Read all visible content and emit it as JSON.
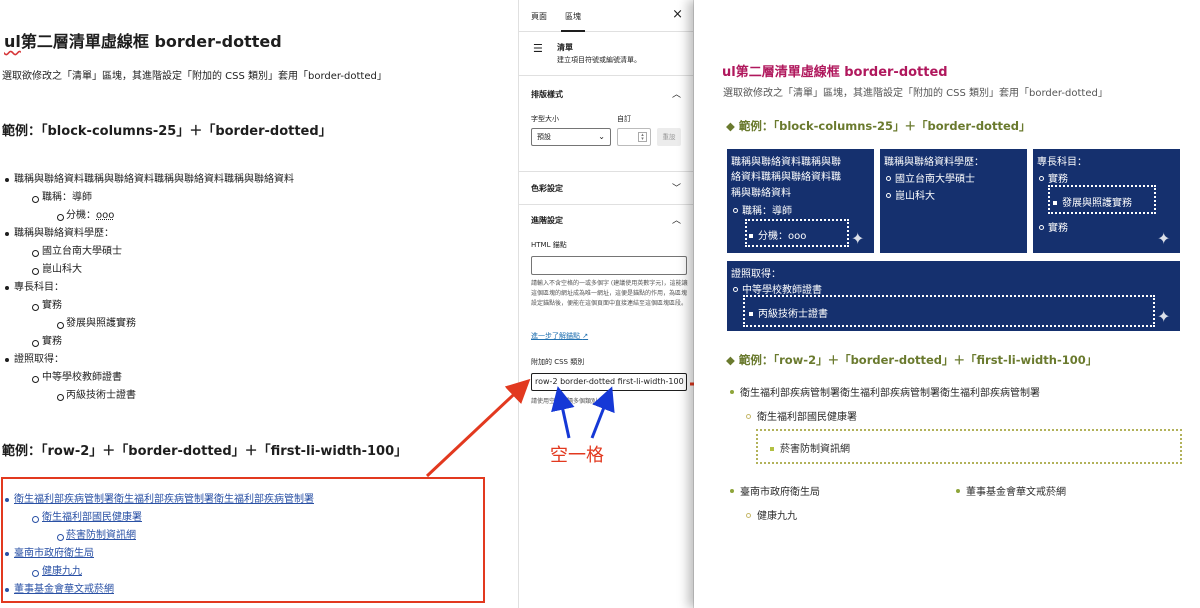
{
  "editor": {
    "title_prefix": "ul",
    "title_rest": "第二層清單虛線框 border-dotted",
    "description": "選取欲修改之「清單」區塊，其進階設定「附加的 CSS 類別」套用「border-dotted」",
    "example1_heading": "範例：「block-columns-25」＋「border-dotted」",
    "example2_heading": "範例：「row-2」＋「border-dotted」＋「first-li-width-100」",
    "list1": {
      "a": "職稱與聯絡資料職稱與聯絡資料職稱與聯絡資料職稱與聯絡資料",
      "a1": "職稱：導師",
      "a1a_prefix": "分機：",
      "a1a_value": "ooo",
      "b": "職稱與聯絡資料學歷：",
      "b1": "國立台南大學碩士",
      "b2": "崑山科大",
      "c": "專長科目：",
      "c1": "實務",
      "c1a": "發展與照護實務",
      "c2": "實務",
      "d": "證照取得：",
      "d1": "中等學校教師證書",
      "d1a": "丙級技術士證書"
    },
    "list2": {
      "a": "衛生福利部疾病管制署衛生福利部疾病管制署衛生福利部疾病管制署",
      "a1": "衛生福利部國民健康署",
      "a1a": "菸害防制資訊網",
      "b": "臺南市政府衛生局",
      "b1": "健康九九",
      "c": "董事基金會華文戒菸網"
    }
  },
  "sidebar": {
    "tab_page": "頁面",
    "tab_block": "區塊",
    "close_icon": "×",
    "block_icon": "☰",
    "block_name": "清單",
    "block_desc": "建立項目符號或編號清單。",
    "typography_heading": "排版樣式",
    "font_size_label": "字型大小",
    "custom_label": "自訂",
    "font_size_value": "預設",
    "reset_label": "重設",
    "color_heading": "色彩設定",
    "advanced_heading": "進階設定",
    "html_anchor_label": "HTML 錨點",
    "html_anchor_help": "請輸入不含空格的一或多個字 (建議使用英數字元)，這能讓這個區塊的網址成為唯一網址，這便是錨點的作用，為區塊設定錨點後，便能在這個頁面中直接連結至這個區塊區段。",
    "learn_more": "進一步了解錨點",
    "css_class_label": "附加的 CSS 類別",
    "css_class_value": "row-2 border-dotted first-li-width-100",
    "css_class_help": "請使用空格分隔多個類別。"
  },
  "annotation": "空一格",
  "preview": {
    "title": "ul第二層清單虛線框 border-dotted",
    "description": "選取欲修改之「清單」區塊，其進階設定「附加的 CSS 類別」套用「border-dotted」",
    "example1_heading": "◆ 範例：「block-columns-25」＋「border-dotted」",
    "example2_heading": "◆ 範例：「row-2」＋「border-dotted」＋「first-li-width-100」",
    "card1": {
      "l1": "職稱與聯絡資料職稱與聯",
      "l2": "絡資料職稱與聯絡資料職",
      "l3": "稱與聯絡資料",
      "sub": "職稱：導師",
      "boxed": "分機：ooo"
    },
    "card2": {
      "l1": "職稱與聯絡資料學歷：",
      "sub1": "國立台南大學碩士",
      "sub2": "崑山科大"
    },
    "card3": {
      "l1": "專長科目：",
      "sub1": "實務",
      "boxed": "發展與照護實務",
      "sub2": "實務"
    },
    "card4": {
      "l1": "證照取得：",
      "sub1": "中等學校教師證書",
      "boxed": "丙級技術士證書"
    },
    "list": {
      "a": "衛生福利部疾病管制署衛生福利部疾病管制署衛生福利部疾病管制署",
      "a1": "衛生福利部國民健康署",
      "a1a": "菸害防制資訊網",
      "b": "臺南市政府衛生局",
      "b1": "健康九九",
      "c": "董事基金會華文戒菸網"
    }
  },
  "colors": {
    "card_bg": "#15306e",
    "title_accent": "#b0185d",
    "heading_olive": "#6a7a2e",
    "arrow_red": "#e2391f",
    "arrow_blue": "#1538d6",
    "link_blue": "#2a51a5"
  }
}
